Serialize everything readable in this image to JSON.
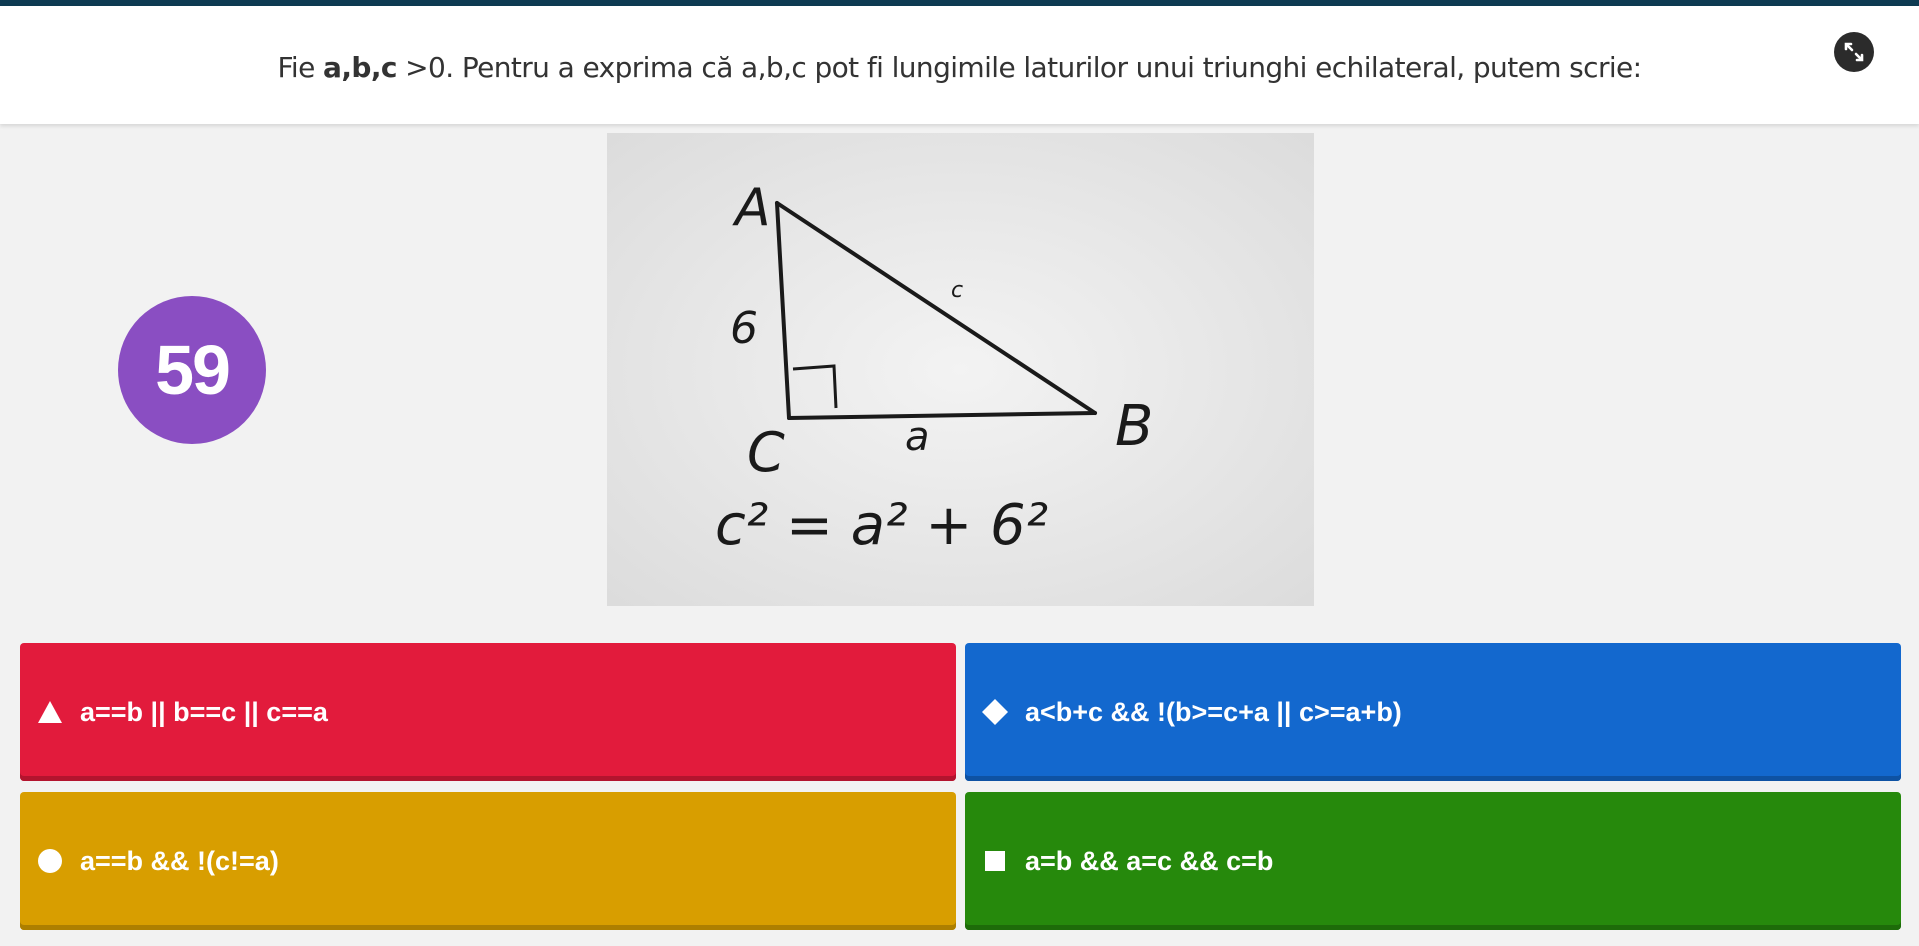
{
  "question": {
    "prefix": "Fie ",
    "bold_vars": "a,b,c",
    "suffix": " >0. Pentru a exprima că a,b,c pot fi lungimile laturilor unui triunghi echilateral, putem scrie:"
  },
  "timer": {
    "value": "59"
  },
  "image": {
    "vertex_a": "A",
    "vertex_b": "B",
    "vertex_c": "C",
    "side_a": "a",
    "side_b": "6",
    "side_c": "c",
    "formula": "c² = a² + 6²"
  },
  "answers": [
    {
      "shape": "triangle-icon",
      "text": "a==b || b==c || c==a",
      "color": "#e21b3c"
    },
    {
      "shape": "diamond-icon",
      "text": "a<b+c && !(b>=c+a || c>=a+b)",
      "color": "#1368ce"
    },
    {
      "shape": "circle-icon",
      "text": "a==b && !(c!=a)",
      "color": "#d89e00"
    },
    {
      "shape": "square-icon",
      "text": "a=b && a=c && c=b",
      "color": "#26890c"
    }
  ]
}
